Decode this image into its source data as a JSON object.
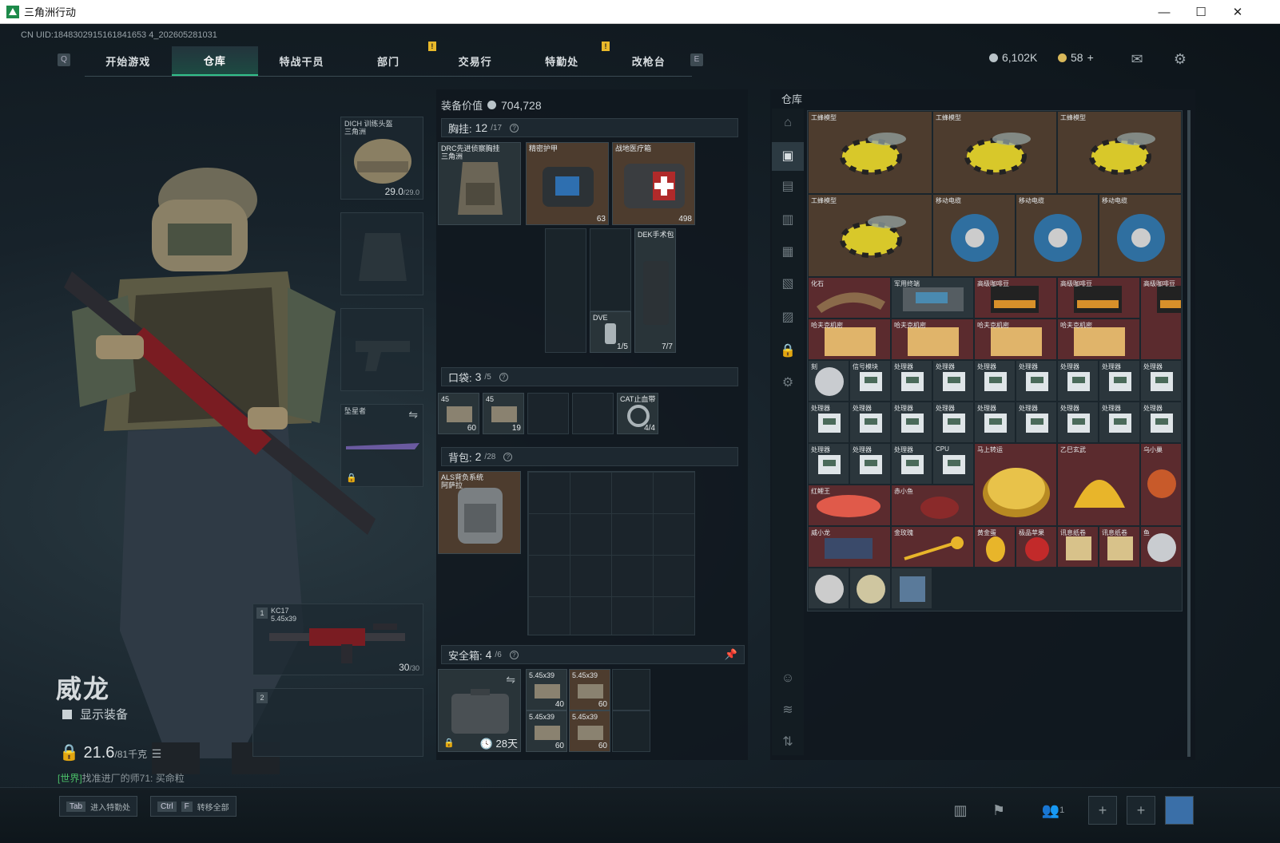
{
  "window": {
    "title": "三角洲行动",
    "minimize": "—",
    "maximize": "☐",
    "close": "✕"
  },
  "uid": "CN UID:1848302915161841653 4_202605281031",
  "nav": {
    "key_left": "Q",
    "key_right": "E",
    "tabs": [
      "开始游戏",
      "仓库",
      "特战干员",
      "部门",
      "交易行",
      "特勤处",
      "改枪台"
    ],
    "active": "仓库",
    "alert": "!"
  },
  "currency": {
    "silver": "6,102K",
    "gold": "58",
    "plus": "+"
  },
  "character": {
    "name": "威龙",
    "show_equipment": "显示装备",
    "weight": "21.6",
    "weight_max": "/81千克"
  },
  "chat": {
    "channel": "[世界]",
    "text": "找准进厂的师71: 买命粒"
  },
  "gear": {
    "helmet": {
      "label": "DICH 训练头盔",
      "sub": "三角洲",
      "durability": "29.0",
      "durability_max": "/29.0"
    },
    "melee": {
      "label": "坠星者"
    },
    "primary": {
      "slot": "1",
      "label": "KC17",
      "caliber": "5.45x39",
      "ammo": "30",
      "ammo_max": "/30"
    },
    "secondary": {
      "slot": "2"
    }
  },
  "equipment": {
    "value_label": "装备价值",
    "value": "704,728",
    "chest": {
      "title": "胸挂:",
      "used": "12",
      "cap": "/17",
      "q": "?"
    },
    "chest_items": [
      {
        "label": "DRC先进侦察胸挂",
        "sub": "三角洲"
      },
      {
        "label": "精密护甲",
        "cnt": "63"
      },
      {
        "label": "战地医疗箱",
        "cnt": "498"
      },
      {
        "label": "DVE",
        "cnt": "1/5"
      },
      {
        "label": "DEK手术包",
        "cnt": "7/7"
      }
    ],
    "pocket": {
      "title": "口袋:",
      "used": "3",
      "cap": "/5",
      "q": "?"
    },
    "pocket_items": [
      {
        "label": "45",
        "cnt": "60"
      },
      {
        "label": "45",
        "cnt": "19"
      },
      {
        "label": "CAT止血带",
        "cnt": "4/4"
      }
    ],
    "backpack": {
      "title": "背包:",
      "used": "2",
      "cap": "/28",
      "q": "?"
    },
    "backpack_item": {
      "label": "ALS背负系统",
      "sub": "阿萨拉"
    },
    "safebox": {
      "title": "安全箱:",
      "used": "4",
      "cap": "/6",
      "q": "?",
      "days": "28天"
    },
    "safebox_items": [
      {
        "label": "5.45x39",
        "cnt": "40"
      },
      {
        "label": "5.45x39",
        "cnt": "60"
      },
      {
        "label": "5.45x39",
        "cnt": "60"
      },
      {
        "label": "5.45x39",
        "cnt": "60"
      }
    ]
  },
  "warehouse": {
    "title": "仓库",
    "items": [
      {
        "label": "工蜂模型"
      },
      {
        "label": "工蜂模型"
      },
      {
        "label": "工蜂模型"
      },
      {
        "label": "工蜂模型"
      },
      {
        "label": "移动电缆"
      },
      {
        "label": "移动电缆"
      },
      {
        "label": "移动电缆"
      },
      {
        "label": "化石"
      },
      {
        "label": "军用终端"
      },
      {
        "label": "高级咖啡豆"
      },
      {
        "label": "高级咖啡豆"
      },
      {
        "label": "高级咖啡豆"
      },
      {
        "label": "哈夫克机密"
      },
      {
        "label": "哈夫克机密"
      },
      {
        "label": "哈夫克机密"
      },
      {
        "label": "哈夫克机密"
      },
      {
        "label": "刻"
      },
      {
        "label": "信号模块"
      },
      {
        "label": "处理器"
      },
      {
        "label": "处理器"
      },
      {
        "label": "CPU"
      },
      {
        "label": "马上转运"
      },
      {
        "label": "乙巳玄武"
      },
      {
        "label": "乌小巢"
      },
      {
        "label": "红鲤王"
      },
      {
        "label": "赤小鱼"
      },
      {
        "label": "威小龙"
      },
      {
        "label": "金玫瑰"
      },
      {
        "label": "黄金蛋"
      },
      {
        "label": "极品苹果"
      },
      {
        "label": "讯息纸卷"
      },
      {
        "label": "讯息纸卷"
      },
      {
        "label": "鱼"
      }
    ]
  },
  "bottom": {
    "tab_key": "Tab",
    "tab_label": "进入特勤处",
    "ctrl_key": "Ctrl",
    "f_key": "F",
    "transfer_label": "转移全部",
    "friends": "1"
  }
}
